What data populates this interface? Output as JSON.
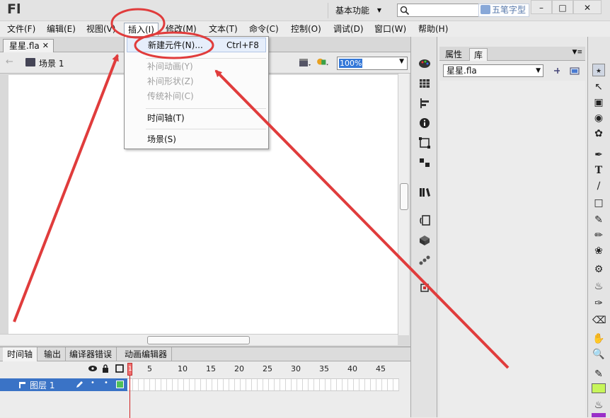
{
  "app": {
    "logo": "Fl",
    "workspace": "基本功能",
    "ime_label": "五笔字型"
  },
  "menu": [
    {
      "label": "文件(F)"
    },
    {
      "label": "编辑(E)"
    },
    {
      "label": "视图(V)"
    },
    {
      "label": "插入(I)"
    },
    {
      "label": "修改(M)"
    },
    {
      "label": "文本(T)"
    },
    {
      "label": "命令(C)"
    },
    {
      "label": "控制(O)"
    },
    {
      "label": "调试(D)"
    },
    {
      "label": "窗口(W)"
    },
    {
      "label": "帮助(H)"
    }
  ],
  "insert_menu": {
    "new_symbol": {
      "label": "新建元件(N)...",
      "shortcut": "Ctrl+F8"
    },
    "motion_tween": "补间动画(Y)",
    "shape_tween": "补间形状(Z)",
    "classic_tween": "传统补间(C)",
    "timeline": "时间轴(T)",
    "scene": "场景(S)"
  },
  "document": {
    "tab": "星星.fla",
    "scene": "场景 1",
    "zoom": "100%"
  },
  "timeline": {
    "tabs": [
      "时间轴",
      "输出",
      "编译器错误",
      "动画编辑器"
    ],
    "frame_numbers": [
      "1",
      "5",
      "10",
      "15",
      "20",
      "25",
      "30",
      "35",
      "40",
      "45"
    ],
    "layer_name": "图层 1",
    "playhead_frame": "1"
  },
  "properties": {
    "tabs": [
      "属性",
      "库"
    ],
    "library_file": "星星.fla"
  },
  "colors": {
    "accent": "#3a73c6",
    "annotation": "#e03c3c",
    "fill_swatch": "#c7f55a",
    "stroke_swatch": "#9a2fc8"
  }
}
